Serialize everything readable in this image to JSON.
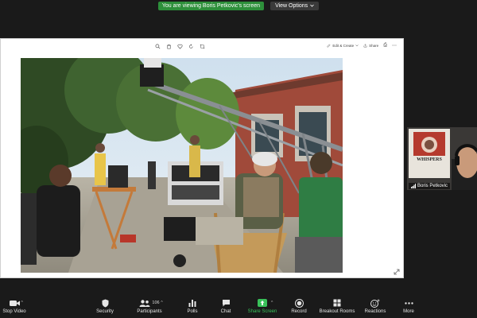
{
  "share_banner": {
    "viewing_text": "You are viewing Boris Petkovic's screen",
    "view_options_label": "View Options",
    "view_options_caret": "chevron-down-icon"
  },
  "shared_window": {
    "toolbar": {
      "share_label": "Share",
      "edit_create_label": "Edit & Create"
    },
    "photo_alt": "Film crew on set with camera crane"
  },
  "participant": {
    "name": "Boris Petkovic",
    "poster_text": "WHISPERS"
  },
  "controls": {
    "stop_video": "Stop Video",
    "security": "Security",
    "participants": "Participants",
    "participants_count": "106",
    "polls": "Polls",
    "chat": "Chat",
    "share_screen": "Share Screen",
    "record": "Record",
    "breakout_rooms": "Breakout Rooms",
    "reactions": "Reactions",
    "more": "More"
  },
  "colors": {
    "banner_green": "#2d8f3a",
    "share_screen_green": "#39c15a",
    "background": "#1a1a1a"
  }
}
